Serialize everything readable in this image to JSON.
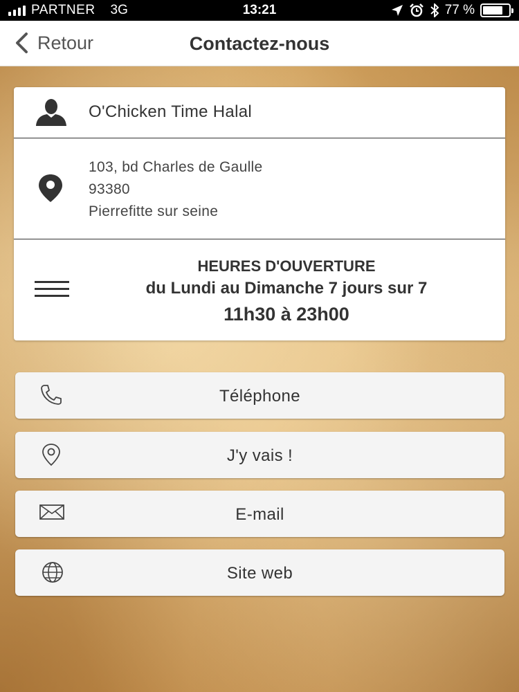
{
  "status_bar": {
    "carrier": "PARTNER",
    "network": "3G",
    "time": "13:21",
    "battery": "77 %",
    "battery_level": 0.77
  },
  "nav": {
    "back_label": "Retour",
    "title": "Contactez-nous"
  },
  "info": {
    "name": "O'Chicken Time Halal",
    "address_line1": "103, bd Charles de Gaulle",
    "address_line2": "93380",
    "address_line3": "Pierrefitte sur seine",
    "hours_title": "HEURES D'OUVERTURE",
    "hours_days": "du Lundi au Dimanche 7 jours sur 7",
    "hours_time": "11h30 à 23h00"
  },
  "actions": [
    {
      "label": "Téléphone",
      "icon": "phone-icon"
    },
    {
      "label": "J'y vais !",
      "icon": "map-pin-icon"
    },
    {
      "label": "E-mail",
      "icon": "envelope-icon"
    },
    {
      "label": "Site web",
      "icon": "globe-icon"
    }
  ],
  "colors": {
    "text": "#333333",
    "button_bg": "#f4f4f4",
    "paper": "#e0b677"
  }
}
